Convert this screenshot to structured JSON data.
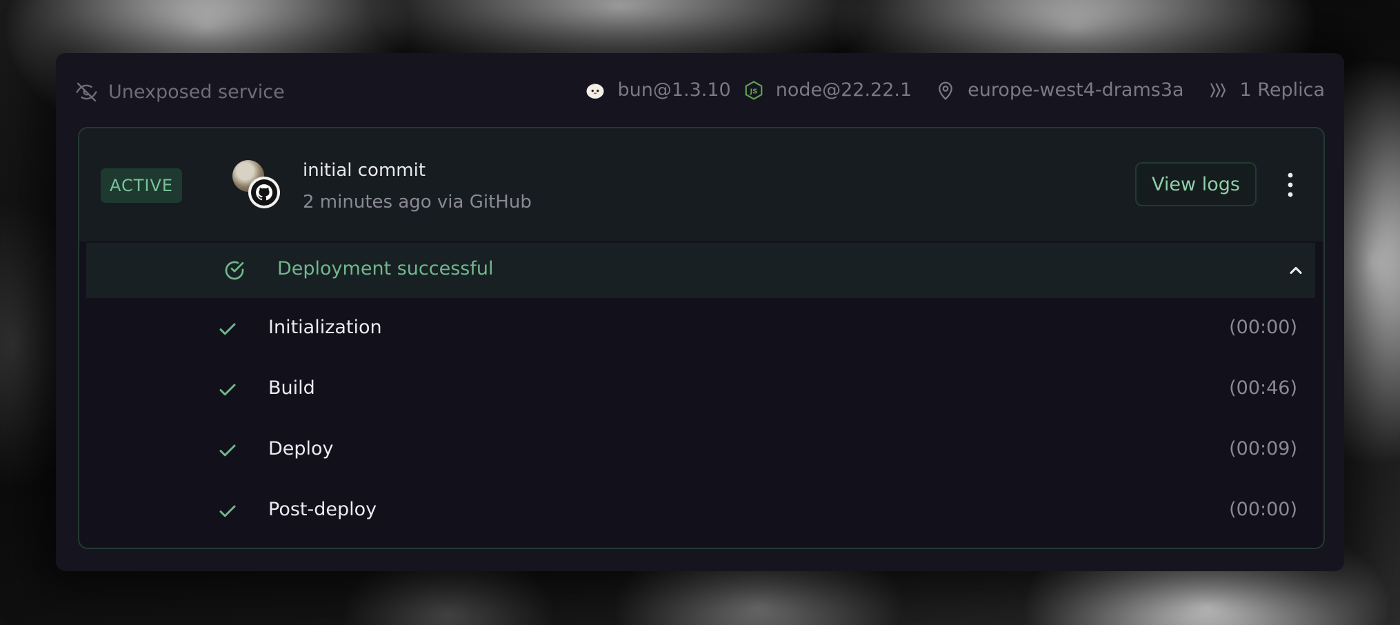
{
  "header": {
    "visibility_label": "Unexposed service",
    "visibility_icon": "eye-off-icon",
    "runtimes": [
      {
        "icon": "bun-icon",
        "label": "bun@1.3.10"
      },
      {
        "icon": "nodejs-icon",
        "label": "node@22.22.1"
      }
    ],
    "region": {
      "icon": "map-pin-icon",
      "label": "europe-west4-drams3a"
    },
    "replicas": {
      "icon": "replica-icon",
      "label": "1 Replica"
    }
  },
  "deployment": {
    "status_badge": "ACTIVE",
    "commit_title": "initial commit",
    "commit_meta": "2 minutes ago via GitHub",
    "view_logs_label": "View logs",
    "status_message": "Deployment successful",
    "steps": [
      {
        "name": "Initialization",
        "duration": "(00:00)"
      },
      {
        "name": "Build",
        "duration": "(00:46)"
      },
      {
        "name": "Deploy",
        "duration": "(00:09)"
      },
      {
        "name": "Post-deploy",
        "duration": "(00:00)"
      }
    ]
  },
  "colors": {
    "success": "#70b88d",
    "card_bg": "#15141f",
    "badge_bg": "#1e3a30",
    "nodejs": "#5fa04e"
  }
}
